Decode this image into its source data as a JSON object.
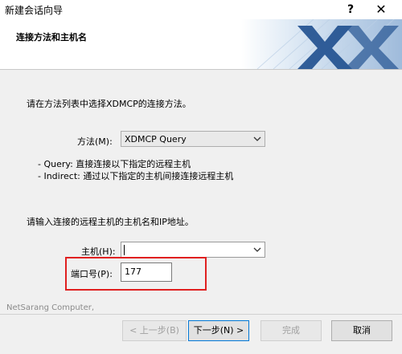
{
  "window": {
    "title": "新建会话向导",
    "help": "?",
    "close": "✕"
  },
  "banner": {
    "title": "连接方法和主机名"
  },
  "method_section": {
    "instruction": "请在方法列表中选择XDMCP的连接方法。",
    "method_label": "方法(M):",
    "method_value": "XDMCP Query",
    "notes": [
      "- Query: 直接连接以下指定的远程主机",
      "- Indirect: 通过以下指定的主机间接连接远程主机"
    ]
  },
  "host_section": {
    "instruction": "请输入连接的远程主机的主机名和IP地址。",
    "host_label": "主机(H):",
    "host_value": "",
    "port_label": "端口号(P):",
    "port_value": "177"
  },
  "footer": {
    "company": "NetSarang Computer,",
    "back": "< 上一步(B)",
    "next": "下一步(N) >",
    "finish": "完成",
    "cancel": "取消"
  },
  "colors": {
    "highlight": "#e02020",
    "banner_art": "#1f4f8f"
  }
}
